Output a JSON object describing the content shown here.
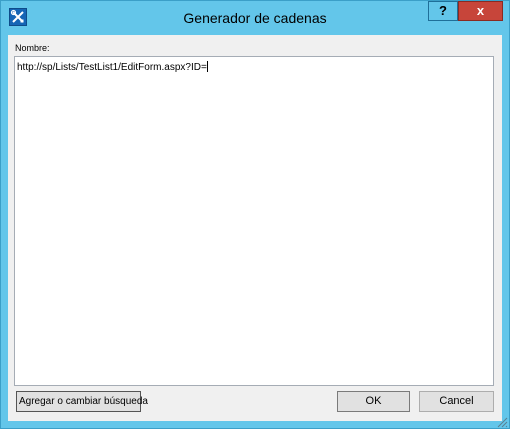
{
  "window": {
    "title": "Generador de cadenas",
    "help_label": "?",
    "close_label": "x"
  },
  "form": {
    "name_label": "Nombre:",
    "name_value": "http://sp/Lists/TestList1/EditForm.aspx?ID="
  },
  "buttons": {
    "add_label": "Agregar o cambiar búsqueda",
    "ok_label": "OK",
    "cancel_label": "Cancel"
  },
  "icons": {
    "app": "tools-icon",
    "resize": "resize-grip-icon"
  },
  "colors": {
    "titlebar": "#63c6ea",
    "close": "#c7453a",
    "client": "#f0f0f0"
  }
}
